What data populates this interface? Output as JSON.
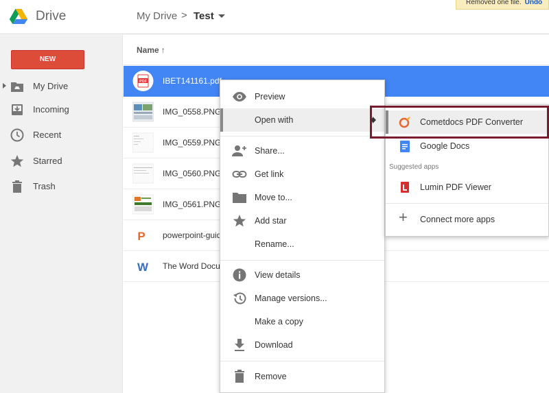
{
  "header": {
    "app_title": "Drive",
    "breadcrumb_root": "My Drive",
    "breadcrumb_separator": ">",
    "breadcrumb_current": "Test",
    "toast_text": "Removed one file.",
    "toast_action": "Undo"
  },
  "sidebar": {
    "new_label": "NEW",
    "items": [
      {
        "label": "My Drive",
        "icon": "drive-folder-icon"
      },
      {
        "label": "Incoming",
        "icon": "incoming-icon"
      },
      {
        "label": "Recent",
        "icon": "clock-icon"
      },
      {
        "label": "Starred",
        "icon": "star-icon"
      },
      {
        "label": "Trash",
        "icon": "trash-icon"
      }
    ]
  },
  "list": {
    "column_name": "Name",
    "sort_indicator": "↑",
    "files": [
      {
        "name": "IBET141161.pdf",
        "type": "pdf",
        "thumb_label": "PDF"
      },
      {
        "name": "IMG_0558.PNG",
        "type": "image"
      },
      {
        "name": "IMG_0559.PNG",
        "type": "image"
      },
      {
        "name": "IMG_0560.PNG",
        "type": "image"
      },
      {
        "name": "IMG_0561.PNG",
        "type": "image"
      },
      {
        "name": "powerpoint-guid",
        "type": "powerpoint",
        "thumb_label": "P"
      },
      {
        "name": "The Word Docu",
        "type": "word",
        "thumb_label": "W"
      }
    ]
  },
  "context_menu": {
    "items": [
      {
        "label": "Preview",
        "icon": "eye-icon"
      },
      {
        "label": "Open with",
        "icon": ""
      },
      {
        "label": "Share...",
        "icon": "person-add-icon"
      },
      {
        "label": "Get link",
        "icon": "link-icon"
      },
      {
        "label": "Move to...",
        "icon": "folder-icon"
      },
      {
        "label": "Add star",
        "icon": "star-icon"
      },
      {
        "label": "Rename...",
        "icon": ""
      },
      {
        "label": "View details",
        "icon": "info-icon"
      },
      {
        "label": "Manage versions...",
        "icon": "history-icon"
      },
      {
        "label": "Make a copy",
        "icon": ""
      },
      {
        "label": "Download",
        "icon": "download-icon"
      },
      {
        "label": "Remove",
        "icon": "trash-icon"
      }
    ]
  },
  "open_with_menu": {
    "apps": [
      {
        "label": "Cometdocs PDF Converter",
        "icon": "cometdocs-icon"
      },
      {
        "label": "Google Docs",
        "icon": "google-docs-icon"
      }
    ],
    "suggested_heading": "Suggested apps",
    "suggested": [
      {
        "label": "Lumin PDF Viewer",
        "icon": "lumin-icon"
      }
    ],
    "connect_label": "Connect more apps",
    "connect_symbol": "+"
  },
  "colors": {
    "selected_row": "#4285f4",
    "new_button": "#dd4b39",
    "annotation_box": "#7a1a2e"
  }
}
